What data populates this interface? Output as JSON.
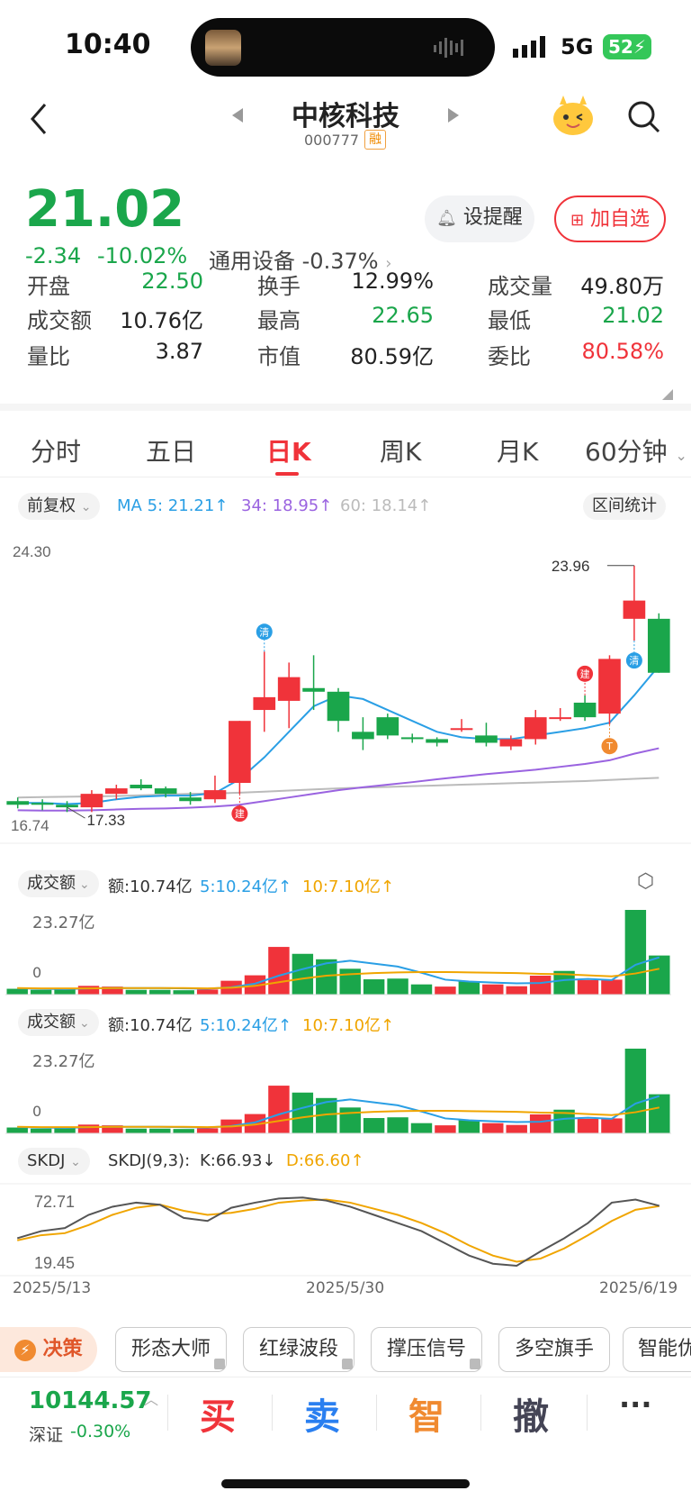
{
  "status": {
    "time": "10:40",
    "network": "5G",
    "battery": "52"
  },
  "header": {
    "title": "中核科技",
    "code": "000777",
    "tag": "融"
  },
  "quote": {
    "price": "21.02",
    "change": "-2.34",
    "change_pct": "-10.02%",
    "sector_name": "通用设备",
    "sector_pct": "-0.37%",
    "alert_label": "设提醒",
    "add_label": "加自选"
  },
  "stats": [
    {
      "label": "开盘",
      "value": "22.50",
      "color": "green"
    },
    {
      "label": "换手",
      "value": "12.99%",
      "color": "dark"
    },
    {
      "label": "成交量",
      "value": "49.80万",
      "color": "dark"
    },
    {
      "label": "成交额",
      "value": "10.76亿",
      "color": "dark"
    },
    {
      "label": "最高",
      "value": "22.65",
      "color": "green"
    },
    {
      "label": "最低",
      "value": "21.02",
      "color": "green"
    },
    {
      "label": "量比",
      "value": "3.87",
      "color": "dark"
    },
    {
      "label": "市值",
      "value": "80.59亿",
      "color": "dark"
    },
    {
      "label": "委比",
      "value": "80.58%",
      "color": "red"
    }
  ],
  "tabs": [
    "分时",
    "五日",
    "日K",
    "周K",
    "月K",
    "60分钟"
  ],
  "active_tab": "日K",
  "ma_legend": {
    "adjust": "前复权",
    "ma5": "MA 5: 21.21↑",
    "ma34": "34: 18.95↑",
    "ma60": "60: 18.14↑",
    "range_stats": "区间统计"
  },
  "colors": {
    "up": "#f0333a",
    "down": "#1aa64b",
    "ma5": "#2a9fe5",
    "ma34": "#9a63e0",
    "ma60": "#bbbbbb",
    "ma10": "#f0a500"
  },
  "chart_data": {
    "type": "candlestick",
    "ylim": [
      16.74,
      24.3
    ],
    "y_top_label": "24.30",
    "y_bottom_label": "16.74",
    "high_label": "23.96",
    "low_label": "17.33",
    "candles": [
      {
        "o": 17.5,
        "c": 17.4,
        "h": 17.6,
        "l": 17.3
      },
      {
        "o": 17.45,
        "c": 17.4,
        "h": 17.55,
        "l": 17.25
      },
      {
        "o": 17.4,
        "c": 17.33,
        "h": 17.5,
        "l": 17.2
      },
      {
        "o": 17.33,
        "c": 17.7,
        "h": 17.8,
        "l": 17.2
      },
      {
        "o": 17.7,
        "c": 17.85,
        "h": 17.95,
        "l": 17.55
      },
      {
        "o": 17.95,
        "c": 17.85,
        "h": 18.1,
        "l": 17.8
      },
      {
        "o": 17.85,
        "c": 17.7,
        "h": 17.9,
        "l": 17.6
      },
      {
        "o": 17.6,
        "c": 17.5,
        "h": 17.75,
        "l": 17.4
      },
      {
        "o": 17.55,
        "c": 17.8,
        "h": 18.2,
        "l": 17.45
      },
      {
        "o": 18.0,
        "c": 19.7,
        "h": 19.7,
        "l": 17.7
      },
      {
        "o": 20.0,
        "c": 20.35,
        "h": 21.6,
        "l": 19.4
      },
      {
        "o": 20.25,
        "c": 20.9,
        "h": 21.3,
        "l": 19.5
      },
      {
        "o": 20.6,
        "c": 20.5,
        "h": 21.5,
        "l": 20.0
      },
      {
        "o": 20.5,
        "c": 19.7,
        "h": 20.6,
        "l": 19.4
      },
      {
        "o": 19.4,
        "c": 19.2,
        "h": 19.8,
        "l": 18.9
      },
      {
        "o": 19.8,
        "c": 19.3,
        "h": 19.9,
        "l": 19.2
      },
      {
        "o": 19.25,
        "c": 19.2,
        "h": 19.35,
        "l": 19.1
      },
      {
        "o": 19.2,
        "c": 19.1,
        "h": 19.25,
        "l": 19.0
      },
      {
        "o": 19.5,
        "c": 19.5,
        "h": 19.75,
        "l": 19.4
      },
      {
        "o": 19.3,
        "c": 19.1,
        "h": 19.65,
        "l": 19.0
      },
      {
        "o": 19.0,
        "c": 19.2,
        "h": 19.3,
        "l": 18.9
      },
      {
        "o": 19.2,
        "c": 19.8,
        "h": 20.0,
        "l": 19.05
      },
      {
        "o": 19.8,
        "c": 19.8,
        "h": 20.05,
        "l": 19.7
      },
      {
        "o": 20.2,
        "c": 19.8,
        "h": 20.4,
        "l": 19.7
      },
      {
        "o": 19.9,
        "c": 21.4,
        "h": 21.5,
        "l": 19.6
      },
      {
        "o": 22.5,
        "c": 23.0,
        "h": 23.96,
        "l": 21.9
      },
      {
        "o": 22.5,
        "c": 21.02,
        "h": 22.65,
        "l": 21.02
      }
    ],
    "ma5": [
      17.45,
      17.45,
      17.42,
      17.45,
      17.55,
      17.62,
      17.65,
      17.65,
      17.72,
      18.1,
      18.7,
      19.4,
      20.1,
      20.4,
      20.3,
      20.0,
      19.7,
      19.4,
      19.25,
      19.2,
      19.2,
      19.3,
      19.4,
      19.5,
      19.65,
      20.4,
      21.21
    ],
    "ma34": [
      17.25,
      17.24,
      17.24,
      17.25,
      17.27,
      17.29,
      17.3,
      17.32,
      17.35,
      17.4,
      17.5,
      17.6,
      17.7,
      17.8,
      17.88,
      17.95,
      18.02,
      18.1,
      18.17,
      18.24,
      18.3,
      18.36,
      18.44,
      18.52,
      18.62,
      18.8,
      18.95
    ],
    "ma60": [
      17.6,
      17.61,
      17.62,
      17.63,
      17.64,
      17.66,
      17.68,
      17.7,
      17.71,
      17.73,
      17.76,
      17.79,
      17.82,
      17.85,
      17.87,
      17.89,
      17.91,
      17.93,
      17.95,
      17.97,
      17.99,
      18.01,
      18.03,
      18.05,
      18.08,
      18.11,
      18.14
    ],
    "vol_series": [
      1.6,
      1.3,
      1.4,
      2.4,
      2.2,
      1.3,
      1.3,
      1.2,
      1.4,
      3.8,
      5.3,
      13.1,
      11.2,
      9.7,
      7.1,
      4.2,
      4.4,
      2.8,
      2.2,
      3.6,
      2.8,
      2.3,
      5.2,
      6.5,
      4.0,
      4.1,
      23.27,
      10.74
    ],
    "vol_ma5": [
      1.7,
      1.6,
      1.5,
      1.7,
      1.8,
      1.8,
      1.8,
      1.7,
      1.6,
      2.0,
      3.0,
      5.2,
      7.0,
      8.6,
      9.3,
      8.5,
      7.7,
      6.0,
      4.1,
      3.6,
      3.3,
      3.1,
      3.2,
      4.0,
      4.3,
      4.0,
      8.2,
      10.24
    ],
    "vol_ma10": [
      1.8,
      1.7,
      1.7,
      1.7,
      1.8,
      1.8,
      1.8,
      1.8,
      1.7,
      1.9,
      2.4,
      3.4,
      4.4,
      5.2,
      5.6,
      5.9,
      6.1,
      6.2,
      6.2,
      6.1,
      6.0,
      5.9,
      5.7,
      5.6,
      5.3,
      5.0,
      5.8,
      7.1
    ],
    "skdj_k": [
      35,
      42,
      45,
      58,
      66,
      70,
      68,
      55,
      52,
      65,
      70,
      74,
      75,
      72,
      66,
      58,
      50,
      42,
      30,
      18,
      10,
      8,
      22,
      35,
      50,
      70,
      73,
      66.93
    ],
    "skdj_d": [
      33,
      38,
      40,
      48,
      58,
      65,
      68,
      62,
      58,
      60,
      64,
      70,
      72,
      73,
      70,
      64,
      58,
      50,
      40,
      28,
      18,
      12,
      15,
      25,
      38,
      52,
      63,
      66.6
    ],
    "dates": [
      "2025/5/13",
      "2025/5/30",
      "2025/6/19"
    ]
  },
  "volume_panel": {
    "label": "成交额",
    "amount": "额:10.74亿",
    "ma5": "5:10.24亿↑",
    "ma10": "10:7.10亿↑",
    "ytop": "23.27亿",
    "y0": "0"
  },
  "skdj_panel": {
    "label": "SKDJ",
    "name": "SKDJ(9,3):",
    "k": "K:66.93↓",
    "d": "D:66.60↑",
    "ytop": "72.71",
    "ybottom": "19.45"
  },
  "tools": {
    "decision": "决策",
    "items": [
      "形态大师",
      "红绿波段",
      "撑压信号",
      "多空旗手",
      "智能优"
    ]
  },
  "bottom": {
    "index_value": "10144.57",
    "index_name": "深证",
    "index_pct": "-0.30%",
    "buy": "买",
    "sell": "卖",
    "smart": "智",
    "cancel": "撤",
    "more": "···"
  }
}
